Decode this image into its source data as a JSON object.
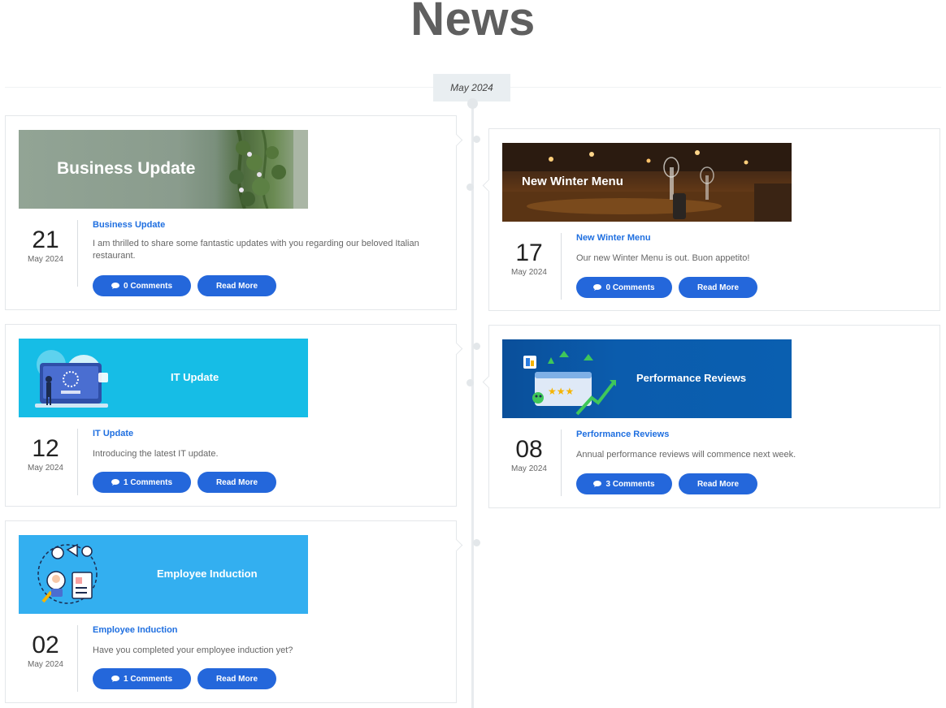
{
  "page": {
    "title": "News"
  },
  "timeline": {
    "month_label": "May 2024"
  },
  "posts": [
    {
      "banner_text": "Business Update",
      "day": "21",
      "month": "May 2024",
      "title": "Business Update",
      "excerpt": "I am thrilled to share some fantastic updates with you regarding our beloved Italian restaurant.",
      "comments_label": "0 Comments",
      "read_more_label": "Read More"
    },
    {
      "banner_text": "New Winter Menu",
      "day": "17",
      "month": "May 2024",
      "title": "New Winter Menu",
      "excerpt": "Our new Winter Menu is out. Buon appetito!",
      "comments_label": "0 Comments",
      "read_more_label": "Read More"
    },
    {
      "banner_text": "IT Update",
      "day": "12",
      "month": "May 2024",
      "title": "IT Update",
      "excerpt": "Introducing the latest IT update.",
      "comments_label": "1 Comments",
      "read_more_label": "Read More"
    },
    {
      "banner_text": "Performance Reviews",
      "day": "08",
      "month": "May 2024",
      "title": "Performance Reviews",
      "excerpt": "Annual performance reviews will commence next week.",
      "comments_label": "3 Comments",
      "read_more_label": "Read More"
    },
    {
      "banner_text": "Employee Induction",
      "day": "02",
      "month": "May 2024",
      "title": "Employee Induction",
      "excerpt": "Have you completed your employee induction yet?",
      "comments_label": "1 Comments",
      "read_more_label": "Read More"
    }
  ],
  "colors": {
    "accent": "#2467db",
    "link": "#1f6fe0",
    "title": "#5f5f5f",
    "it_banner": "#16bde6",
    "performance_banner": "#0a5fb0",
    "induction_banner": "#33aff0"
  }
}
